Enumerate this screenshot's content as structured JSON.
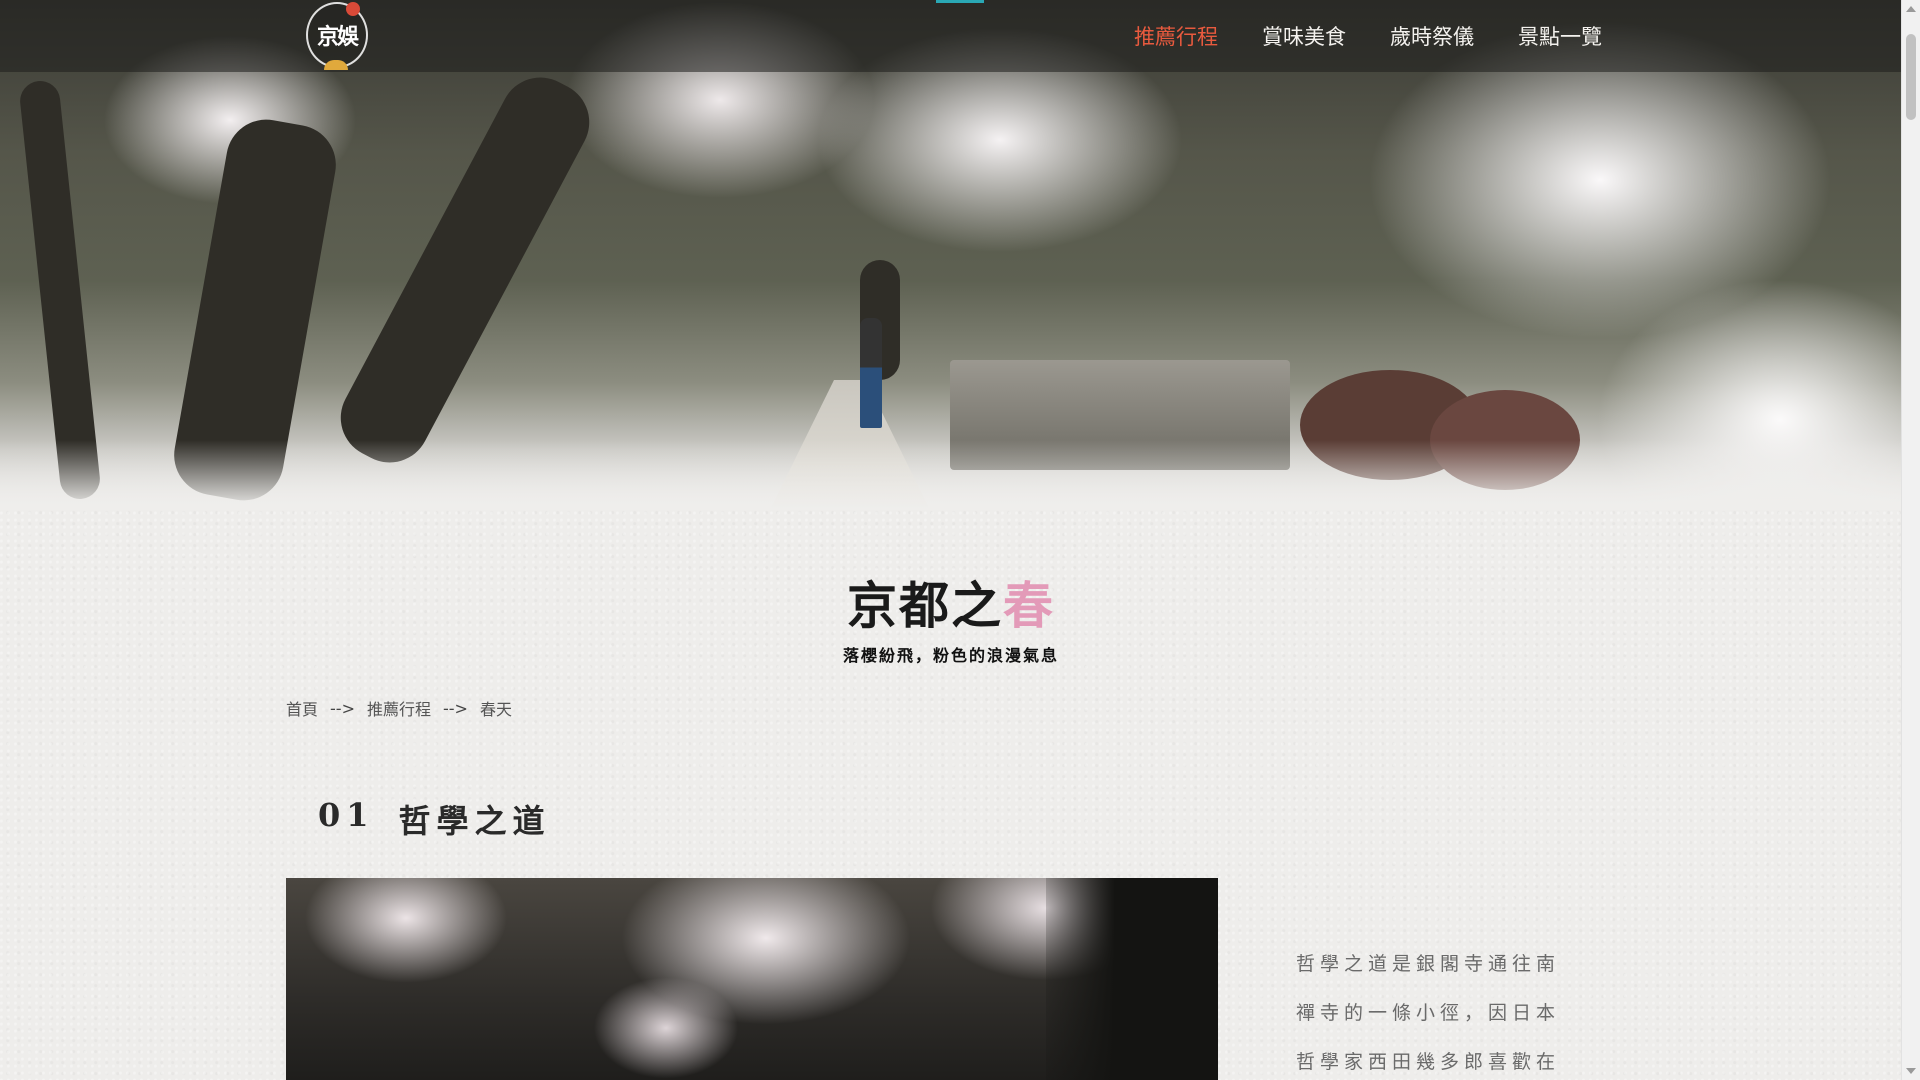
{
  "nav": {
    "logo_text": "京娛",
    "links": [
      {
        "label": "推薦行程",
        "active": true
      },
      {
        "label": "賞味美食",
        "active": false
      },
      {
        "label": "歲時祭儀",
        "active": false
      },
      {
        "label": "景點一覽",
        "active": false
      }
    ]
  },
  "title": {
    "main": "京都之",
    "accent": "春",
    "subtitle": "落櫻紛飛，粉色的浪漫氣息"
  },
  "breadcrumb": {
    "items": [
      "首頁",
      "推薦行程",
      "春天"
    ],
    "separator": "-->"
  },
  "section": {
    "number": "01",
    "name": "哲學之道",
    "text": "哲學之道是銀閣寺通往南禪寺的一條小徑，因日本哲學家西田幾多郎喜歡在"
  },
  "colors": {
    "active_nav": "#e85a3e",
    "title_accent": "#e39ab8",
    "nav_accent_bar": "#2aa8b5"
  }
}
